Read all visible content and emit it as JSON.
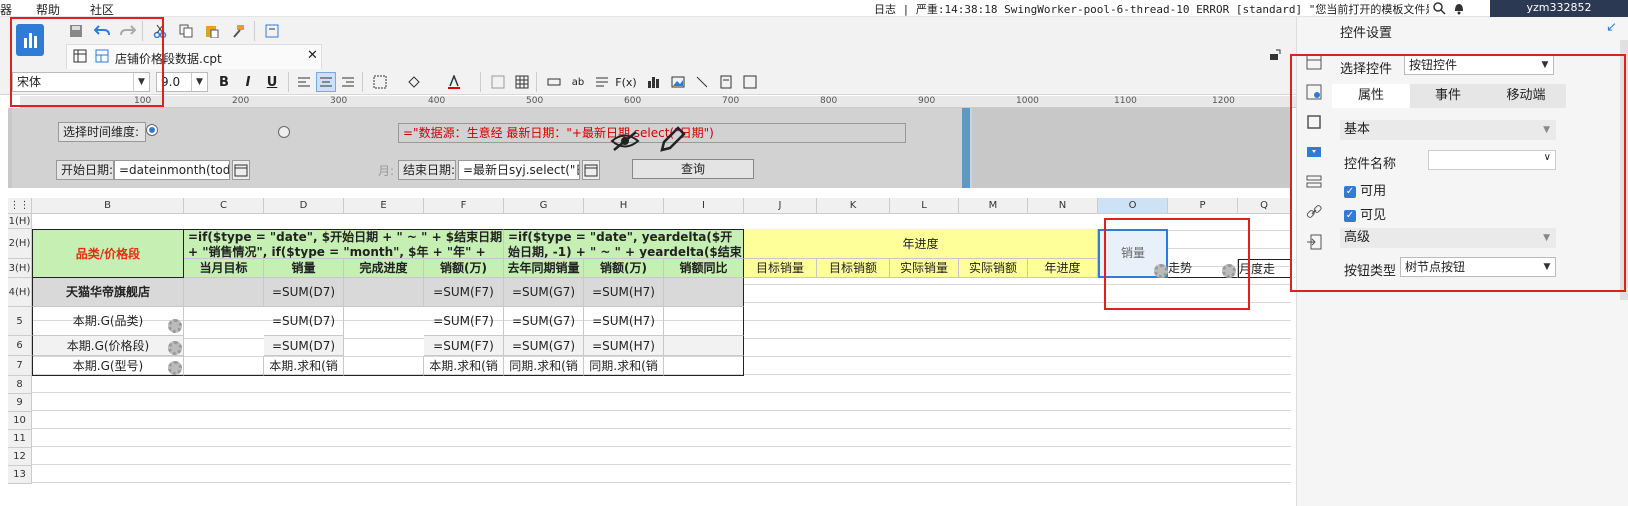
{
  "menu": {
    "m1": "器",
    "m2": "帮助",
    "m3": "社区"
  },
  "status": {
    "log_text": "日志 | 严重:14:38:18 SwingWorker-pool-6-thread-10 ERROR [standard] \"您当前打开的模板文件是由更高...",
    "user": "yzm332852"
  },
  "editor": {
    "tab_label": "店铺价格段数据.cpt",
    "font_name": "宋体",
    "font_size": "9.0",
    "bold": "B",
    "italic": "I",
    "underline": "U"
  },
  "ruler": [
    "100",
    "200",
    "300",
    "400",
    "500",
    "600",
    "700",
    "800",
    "900",
    "1000",
    "1100",
    "1200"
  ],
  "params": {
    "time_dim_label": "选择时间维度:",
    "formula_text": "=\"数据源：生意经    最新日期：\"+最新日期.select(\"日期\")",
    "start_label": "开始日期:",
    "start_value": "=dateinmonth(today(",
    "month_label": "月:",
    "end_label": "结束日期:",
    "end_value": "=最新日syj.select(\"日期",
    "query_btn": "查询"
  },
  "grid": {
    "col_headers": [
      "B",
      "C",
      "D",
      "E",
      "F",
      "G",
      "H",
      "I",
      "J",
      "K",
      "L",
      "M",
      "N",
      "O",
      "P",
      "Q"
    ],
    "row_headers": [
      "1(H)",
      "2(H)",
      "3(H)",
      "4(H)",
      "5",
      "6",
      "7",
      "8",
      "9",
      "10",
      "11",
      "12",
      "13"
    ],
    "category_header": "品类/价格段",
    "formula_c2": "=if($type = \"date\", $开始日期 + \" ~ \" + $结束日期 + \"销售情况\", if($type = \"month\", $年 + \"年\" + $月",
    "formula_g2": "=if($type = \"date\", yeardelta($开始日期, -1) + \" ~ \" + yeardelta($结束日期",
    "year_progress": "年进度",
    "o_cell": "销量",
    "p_cell": "走势",
    "q_cell": "月度走",
    "row3": [
      "当月目标",
      "销量",
      "完成进度",
      "销额(万)",
      "去年同期销量",
      "销额(万)",
      "销额同比",
      "目标销量",
      "目标销额",
      "实际销量",
      "实际销额",
      "年进度"
    ],
    "row4": {
      "b": "天猫华帝旗舰店",
      "d": "=SUM(D7)",
      "f": "=SUM(F7)",
      "g": "=SUM(G7)",
      "h": "=SUM(H7)"
    },
    "row5": {
      "b": "本期.G(品类)",
      "d": "=SUM(D7)",
      "f": "=SUM(F7)",
      "g": "=SUM(G7)",
      "h": "=SUM(H7)"
    },
    "row6": {
      "b": "本期.G(价格段)",
      "d": "=SUM(D7)",
      "f": "=SUM(F7)",
      "g": "=SUM(G7)",
      "h": "=SUM(H7)"
    },
    "row7": {
      "b": "本期.G(型号)",
      "d": "本期.求和(销",
      "f": "本期.求和(销",
      "g": "同期.求和(销",
      "h": "同期.求和(销"
    }
  },
  "panel": {
    "title": "控件设置",
    "select_label": "选择控件",
    "select_value": "按钮控件",
    "tabs": [
      "属性",
      "事件",
      "移动端"
    ],
    "basic": "基本",
    "name_label": "控件名称",
    "enabled": "可用",
    "visible": "可见",
    "advanced": "高级",
    "btn_type_label": "按钮类型",
    "btn_type_value": "树节点按钮"
  },
  "colors": {
    "accent": "#2f7bd6",
    "header_green": "#c6efb4",
    "header_yellow": "#ffff99",
    "annotation_red": "#e02020",
    "dark_pill": "#2b3952"
  }
}
